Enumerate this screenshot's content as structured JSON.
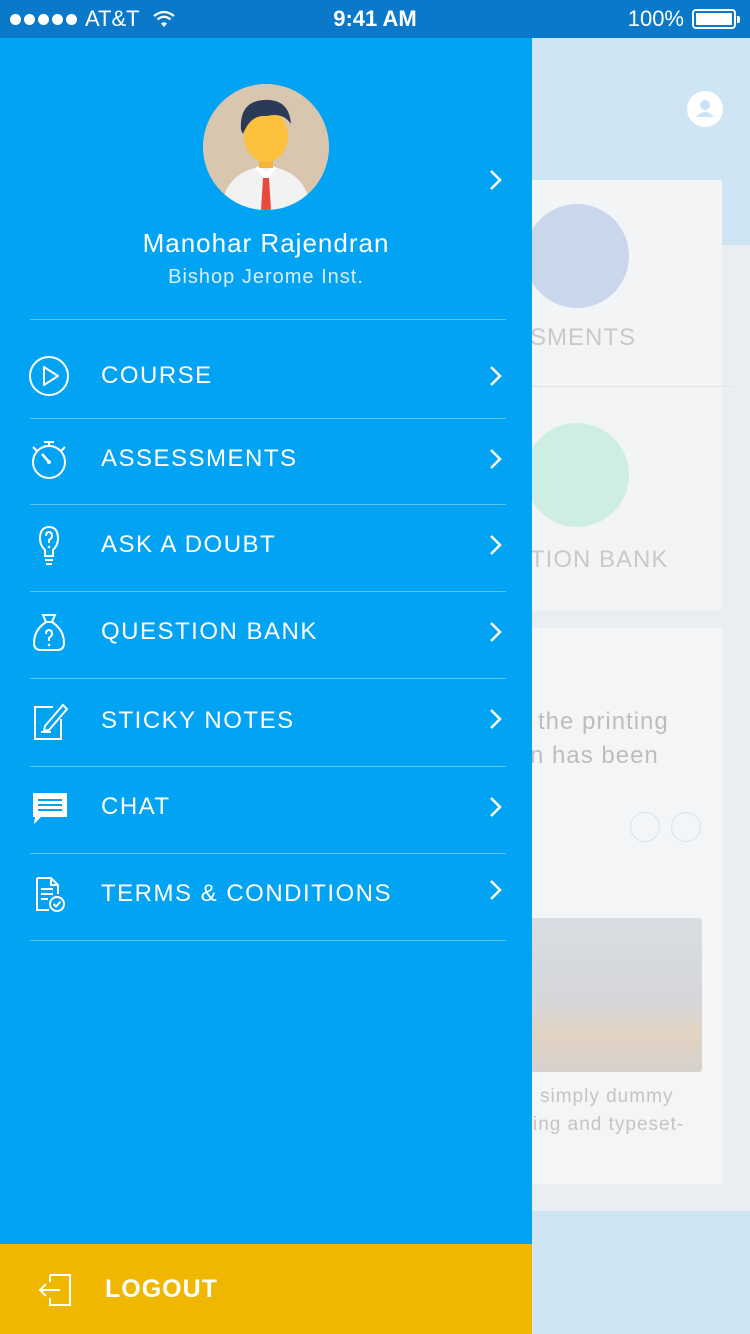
{
  "status_bar": {
    "carrier": "AT&T",
    "time": "9:41 AM",
    "battery": "100%"
  },
  "profile": {
    "name": "Manohar Rajendran",
    "institution": "Bishop Jerome Inst."
  },
  "menu": {
    "items": [
      {
        "label": "COURSE",
        "icon": "play-circle-icon"
      },
      {
        "label": "ASSESSMENTS",
        "icon": "stopwatch-icon"
      },
      {
        "label": "ASK A DOUBT",
        "icon": "lightbulb-question-icon"
      },
      {
        "label": "QUESTION BANK",
        "icon": "question-bag-icon"
      },
      {
        "label": "STICKY NOTES",
        "icon": "note-pencil-icon"
      },
      {
        "label": "CHAT",
        "icon": "chat-bubble-icon"
      },
      {
        "label": "TERMS & CONDITIONS",
        "icon": "document-check-icon"
      }
    ]
  },
  "logout": {
    "label": "LOGOUT",
    "icon": "logout-icon"
  },
  "background": {
    "card1_label1": "SMENTS",
    "card1_label2": "TION BANK",
    "card2_text_line1": "the printing",
    "card2_text_line2": "n has been",
    "card2_caption_line1": "simply dummy",
    "card2_caption_line2": "ing and typeset-"
  },
  "colors": {
    "drawer": "#03a3f4",
    "status_bar": "#0a79c9",
    "logout": "#f0b700"
  }
}
